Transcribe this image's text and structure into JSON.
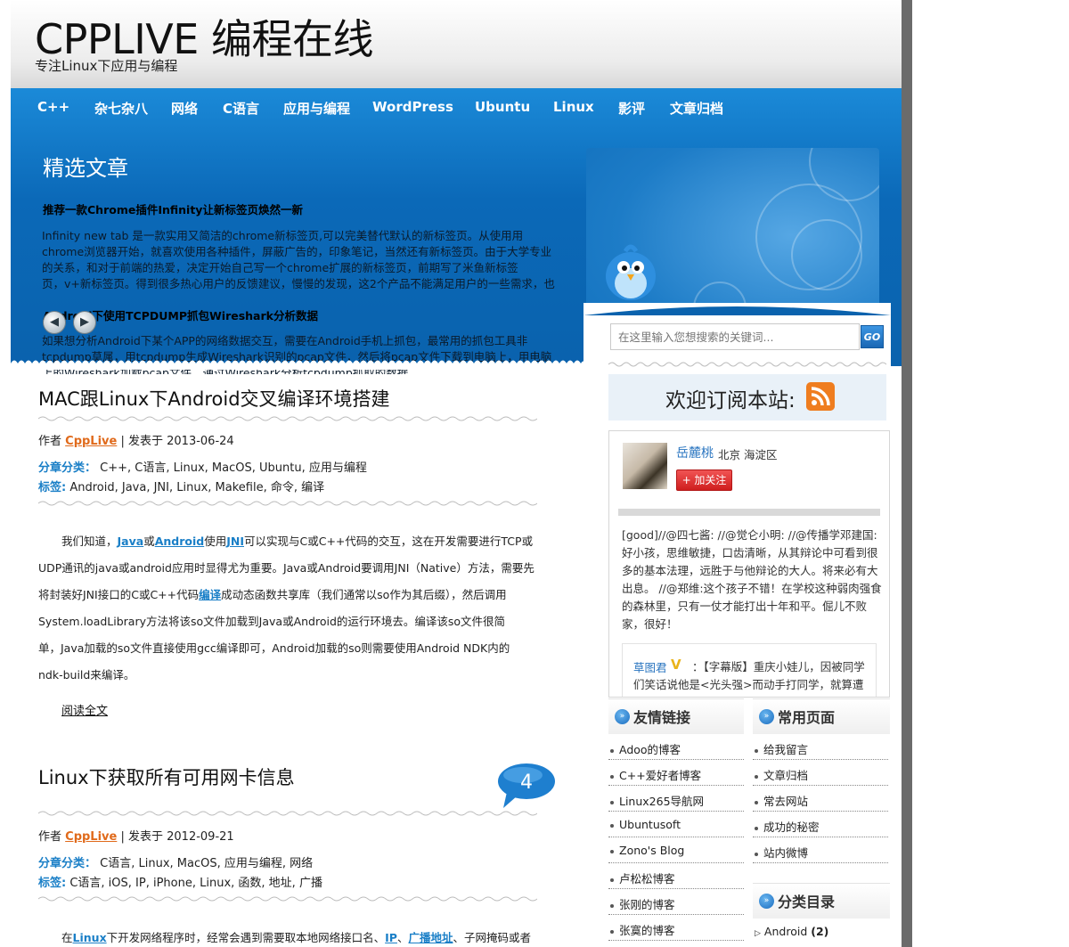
{
  "site": {
    "title": "CPPLIVE 编程在线",
    "subtitle": "专注Linux下应用与编程"
  },
  "nav": [
    "C++",
    "杂七杂八",
    "网络",
    "C语言",
    "应用与编程",
    "WordPress",
    "Ubuntu",
    "Linux",
    "影评",
    "文章归档"
  ],
  "featured": {
    "title": "精选文章",
    "items": [
      {
        "heading": "推荐一款Chrome插件Infinity让新标签页焕然一新",
        "lines": [
          "Infinity new tab 是一款实用又简洁的chrome新标签页,可以完美替代默认的新标签页。从使用用",
          "chrome浏览器开始，就喜欢使用各种插件，屏蔽广告的，印象笔记，当然还有新标签页。由于大学专业",
          "的关系，和对于前端的热爱，决定开始自己写一个chrome扩展的新标签页，前期写了米鱼新标签",
          "页，v+新标签页。得到很多热心用户的反馈建议，慢慢的发现，这2个产品不能满足用户的一些需求，也"
        ]
      },
      {
        "heading": "Android下使用TCPDUMP抓包Wireshark分析数据",
        "lines": [
          "如果想分析Android下某个APP的网络数据交互，需要在Android手机上抓包，最常用的抓包工具非",
          "tcpdump莫属，用tcpdump生成Wireshark识别的pcap文件，然后将pcap文件下载到电脑上，用电脑",
          "上的Wireshark加载pcap文件，通过Wireshark分析tcpdump抓取的数据。"
        ]
      }
    ],
    "prev_icon": "left-arrow-icon",
    "next_icon": "right-arrow-icon"
  },
  "posts": [
    {
      "title": "MAC跟Linux下Android交叉编译环境搭建",
      "author_label": "作者",
      "author": "CppLive",
      "date_label": "| 发表于",
      "date": "2013-06-24",
      "category_label": "分章分类：",
      "categories": "C++, C语言, Linux, MacOS, Ubuntu, 应用与编程",
      "tags_label": "标签:",
      "tags": "Android, Java, JNI, Linux, Makefile, 命令, 编译",
      "body": {
        "l1a": "我们知道，",
        "kw1": "Java",
        "l1b": "或",
        "kw2": "Android",
        "l1c": "使用",
        "kw3": "JNI",
        "l1d": "可以实现与C或C++代码的交互，这在开发需要进行TCP或",
        "l2": "UDP通讯的java或android应用时显得尤为重要。Java或Android要调用JNI（Native）方法，需要先",
        "l3a": "将封装好JNI接口的C或C++代码",
        "kw4": "编译",
        "l3b": "成动态函数共享库（我们通常以so作为其后缀），然后调用",
        "l4": "System.loadLibrary方法将该so文件加载到Java或Android的运行环境去。编译该so文件很简",
        "l5": "单，Java加载的so文件直接使用gcc编译即可，Android加载的so则需要使用Android NDK内的",
        "l6": "ndk-build来编译。"
      },
      "read_more": "阅读全文"
    },
    {
      "title": "Linux下获取所有可用网卡信息",
      "comment_count": "4",
      "author_label": "作者",
      "author": "CppLive",
      "date_label": "| 发表于",
      "date": "2012-09-21",
      "category_label": "分章分类：",
      "categories": "C语言, Linux, MacOS, 应用与编程, 网络",
      "tags_label": "标签:",
      "tags": "C语言, iOS, IP, iPhone, Linux, 函数, 地址, 广播",
      "body": {
        "l1a": "在",
        "kw1": "Linux",
        "l1b": "下开发网络程序时，经常会遇到需要取本地网络接口名、",
        "kw2": "IP",
        "l1c": "、",
        "kw3": "广播地址",
        "l1d": "、子网掩码或者"
      }
    }
  ],
  "sidebar": {
    "search": {
      "placeholder": "在这里输入您想搜索的关键词...",
      "go_label": "GO"
    },
    "subscribe": {
      "text": "欢迎订阅本站:",
      "icon": "rss-icon"
    },
    "weibo": {
      "name": "岳麓桃",
      "location": "北京 海淀区",
      "follow_label": "+ 加关注",
      "post": "[good]//@四七酱: //@觉仑小明: //@传播学邓建国: 好小孩，思维敏捷，口齿清晰，从其辩论中可看到很多的基本法理，远胜于与他辩论的大人。将来必有大出息。 //@郑维:这个孩子不错！在学校这种弱肉强食的森林里，只有一仗才能打出十年和平。倔儿不败家，很好！",
      "quote_author": "草图君",
      "quote_badge": "V",
      "quote_text": "：【字幕版】重庆小娃儿，因被同学们笑话说他是<光头强>而动手打同学，就算遭遇"
    },
    "friends": {
      "title": "友情链接",
      "items": [
        "Adoo的博客",
        "C++爱好者博客",
        "Linux265导航网",
        "Ubuntusoft",
        "Zono's Blog",
        "卢松松博客",
        "张刚的博客",
        "张寞的博客"
      ]
    },
    "pages": {
      "title": "常用页面",
      "items": [
        "给我留言",
        "文章归档",
        "常去网站",
        "成功的秘密",
        "站内微博"
      ]
    },
    "categories": {
      "title": "分类目录",
      "items": [
        {
          "name": "Android",
          "count": "(2)"
        }
      ]
    }
  }
}
